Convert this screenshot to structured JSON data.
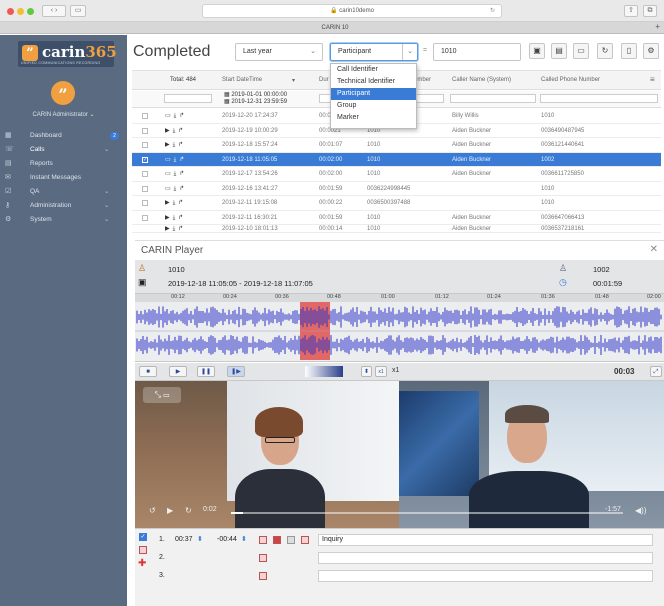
{
  "browser": {
    "url": "carin10demo",
    "tab": "CARIN 10"
  },
  "app": {
    "logo": {
      "brand": "carin",
      "brand_num": "365",
      "tagline": "UNIFIED COMMUNICATIONS RECORDING"
    },
    "user": "CARIN Administrator",
    "nav": [
      {
        "label": "Dashboard",
        "icon": "dashboard-icon",
        "badge": "2"
      },
      {
        "label": "Calls",
        "icon": "calls-icon",
        "chevron": "⌄"
      },
      {
        "label": "Reports",
        "icon": "reports-icon"
      },
      {
        "label": "Instant Messages",
        "icon": "messages-icon"
      },
      {
        "label": "QA",
        "icon": "qa-icon",
        "chevron": "⌄"
      },
      {
        "label": "Administration",
        "icon": "admin-icon",
        "chevron": "⌄"
      },
      {
        "label": "System",
        "icon": "system-icon",
        "chevron": "⌄"
      }
    ]
  },
  "page": {
    "title": "Completed",
    "period": "Last year",
    "filter_field": "Participant",
    "search_value": "1010",
    "filter_options": [
      "Call Identifier",
      "Technical Identifier",
      "Participant",
      "Group",
      "Marker"
    ],
    "filter_selected": "Participant"
  },
  "table": {
    "total_label": "Total: 484",
    "headers": [
      "Start DateTime",
      "Dur",
      "umber",
      "Caller Name (System)",
      "Called Phone Number"
    ],
    "date_from": "2019-01-01 00:00:00",
    "date_to": "2019-12-31 23:59:59",
    "rows": [
      {
        "dt": "2019-12-20 17:24:37",
        "dur": "00:0",
        "num": "",
        "caller": "Billy Willis",
        "called": "1010"
      },
      {
        "dt": "2019-12-19 10:00:29",
        "dur": "00:0021",
        "num": "1010",
        "caller": "Aiden Buckner",
        "called": "0036490487945"
      },
      {
        "dt": "2019-12-18 15:57:24",
        "dur": "00:01:07",
        "num": "1010",
        "caller": "Aiden Buckner",
        "called": "0036121440641"
      },
      {
        "dt": "2019-12-18 11:05:05",
        "dur": "00:02:00",
        "num": "1010",
        "caller": "Aiden Buckner",
        "called": "1002"
      },
      {
        "dt": "2019-12-17 13:54:26",
        "dur": "00:02:00",
        "num": "1010",
        "caller": "Aiden Buckner",
        "called": "0036611725850"
      },
      {
        "dt": "2019-12-16 13:41:27",
        "dur": "00:01:59",
        "num": "0036224998445",
        "caller": "",
        "called": "1010"
      },
      {
        "dt": "2019-12-11 19:15:08",
        "dur": "00:00:22",
        "num": "0036500397488",
        "caller": "",
        "called": "1010"
      },
      {
        "dt": "2019-12-11 16:30:21",
        "dur": "00:01:59",
        "num": "1010",
        "caller": "Aiden Buckner",
        "called": "0036647066413"
      },
      {
        "dt": "2019-12-10 18:01:13",
        "dur": "00:00:14",
        "num": "1010",
        "caller": "Aiden Buckner",
        "called": "0036537218161"
      }
    ]
  },
  "player": {
    "title": "CARIN Player",
    "caller": "1010",
    "called": "1002",
    "time_range": "2019-12-18 11:05:05  -  2019-12-18 11:07:05",
    "duration": "00:01:59",
    "timeline": [
      "00:12",
      "00:24",
      "00:36",
      "00:48",
      "01:00",
      "01:12",
      "01:24",
      "01:36",
      "01:48",
      "02:00"
    ],
    "speed": "x1",
    "position": "00:03",
    "video_elapsed": "0:02",
    "video_remaining": "-1:57",
    "annotations": [
      {
        "n": "1.",
        "start": "00:37",
        "end": "-00:44",
        "text": "Inquiry"
      },
      {
        "n": "2.",
        "start": "",
        "end": "",
        "text": ""
      },
      {
        "n": "3.",
        "start": "",
        "end": "",
        "text": ""
      }
    ],
    "colors": {
      "accent": "#3a7bd5",
      "waveform": "#2c34c8",
      "marker": "#e05050"
    }
  }
}
